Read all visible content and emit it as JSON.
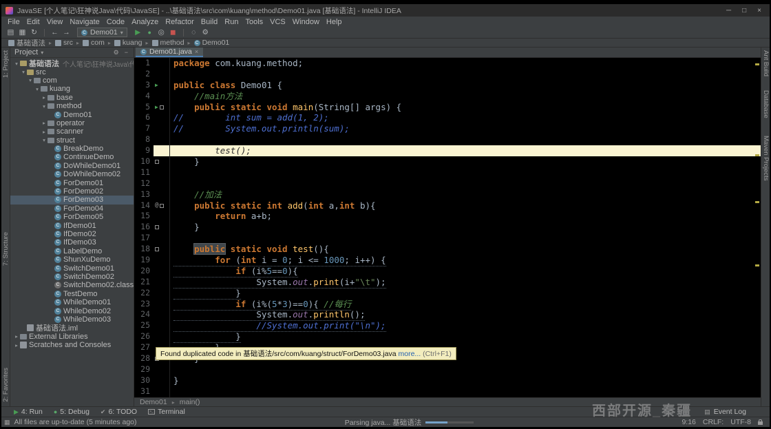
{
  "colors": {
    "keyword": "#CC7832",
    "method": "#FFC66B",
    "number": "#6897BB",
    "string": "#6A8759",
    "comment_green": "#5C9153",
    "comment_blue": "#4E6FD1",
    "static_field": "#9876AA",
    "editor_bg": "#000000",
    "panel_bg": "#3C3F41",
    "caret_line_bg": "#FBF4D2",
    "run_green": "#499C54",
    "tooltip_bg": "#F3EDBE"
  },
  "title_bar": {
    "title": "JavaSE [个人笔记\\狂神说Java\\代码\\JavaSE] - ..\\基础语法\\src\\com\\kuang\\method\\Demo01.java [基础语法] - IntelliJ IDEA",
    "minimize": "─",
    "maximize": "□",
    "close": "×"
  },
  "menu_bar": {
    "items": [
      "File",
      "Edit",
      "View",
      "Navigate",
      "Code",
      "Analyze",
      "Refactor",
      "Build",
      "Run",
      "Tools",
      "VCS",
      "Window",
      "Help"
    ]
  },
  "toolbar": {
    "run_config": "Demo01"
  },
  "nav_breadcrumbs": {
    "items": [
      {
        "label": "基础语法",
        "icon": "folder"
      },
      {
        "label": "src",
        "icon": "folder"
      },
      {
        "label": "com",
        "icon": "package"
      },
      {
        "label": "kuang",
        "icon": "package"
      },
      {
        "label": "method",
        "icon": "package"
      },
      {
        "label": "Demo01",
        "icon": "class"
      }
    ]
  },
  "left_stripe": {
    "items": [
      "1: Project",
      "7: Structure",
      "2: Favorites"
    ]
  },
  "right_stripe": {
    "items": [
      "Ant Build",
      "Database",
      "Maven Projects"
    ]
  },
  "project_panel": {
    "title": "Project",
    "tree": [
      {
        "label": "基础语法",
        "suffix": "个人笔记\\狂神说Java\\代码\\JavaSE",
        "depth": 0,
        "chev": "v",
        "icon": "folder",
        "bold": true
      },
      {
        "label": "src",
        "depth": 1,
        "chev": "v",
        "icon": "folder"
      },
      {
        "label": "com",
        "depth": 2,
        "chev": "v",
        "icon": "package"
      },
      {
        "label": "kuang",
        "depth": 3,
        "chev": "v",
        "icon": "package"
      },
      {
        "label": "base",
        "depth": 4,
        "chev": ">",
        "icon": "package"
      },
      {
        "label": "method",
        "depth": 4,
        "chev": "v",
        "icon": "package"
      },
      {
        "label": "Demo01",
        "depth": 5,
        "chev": "",
        "icon": "class"
      },
      {
        "label": "operator",
        "depth": 4,
        "chev": ">",
        "icon": "package"
      },
      {
        "label": "scanner",
        "depth": 4,
        "chev": ">",
        "icon": "package"
      },
      {
        "label": "struct",
        "depth": 4,
        "chev": "v",
        "icon": "package"
      },
      {
        "label": "BreakDemo",
        "depth": 5,
        "chev": "",
        "icon": "class"
      },
      {
        "label": "ContinueDemo",
        "depth": 5,
        "chev": "",
        "icon": "class"
      },
      {
        "label": "DoWhileDemo01",
        "depth": 5,
        "chev": "",
        "icon": "class"
      },
      {
        "label": "DoWhileDemo02",
        "depth": 5,
        "chev": "",
        "icon": "class"
      },
      {
        "label": "ForDemo01",
        "depth": 5,
        "chev": "",
        "icon": "class"
      },
      {
        "label": "ForDemo02",
        "depth": 5,
        "chev": "",
        "icon": "class"
      },
      {
        "label": "ForDemo03",
        "depth": 5,
        "chev": "",
        "icon": "class",
        "selected": true
      },
      {
        "label": "ForDemo04",
        "depth": 5,
        "chev": "",
        "icon": "class"
      },
      {
        "label": "ForDemo05",
        "depth": 5,
        "chev": "",
        "icon": "class"
      },
      {
        "label": "IfDemo01",
        "depth": 5,
        "chev": "",
        "icon": "class"
      },
      {
        "label": "IfDemo02",
        "depth": 5,
        "chev": "",
        "icon": "class"
      },
      {
        "label": "IfDemo03",
        "depth": 5,
        "chev": "",
        "icon": "class"
      },
      {
        "label": "LabelDemo",
        "depth": 5,
        "chev": "",
        "icon": "class"
      },
      {
        "label": "ShunXuDemo",
        "depth": 5,
        "chev": "",
        "icon": "class"
      },
      {
        "label": "SwitchDemo01",
        "depth": 5,
        "chev": "",
        "icon": "class"
      },
      {
        "label": "SwitchDemo02",
        "depth": 5,
        "chev": "",
        "icon": "class"
      },
      {
        "label": "SwitchDemo02.class",
        "depth": 5,
        "chev": "",
        "icon": "classfile"
      },
      {
        "label": "TestDemo",
        "depth": 5,
        "chev": "",
        "icon": "class"
      },
      {
        "label": "WhileDemo01",
        "depth": 5,
        "chev": "",
        "icon": "class"
      },
      {
        "label": "WhileDemo02",
        "depth": 5,
        "chev": "",
        "icon": "class"
      },
      {
        "label": "WhileDemo03",
        "depth": 5,
        "chev": "",
        "icon": "class"
      },
      {
        "label": "基础语法.iml",
        "depth": 1,
        "chev": "",
        "icon": "file"
      },
      {
        "label": "External Libraries",
        "depth": 0,
        "chev": ">",
        "icon": "lib"
      },
      {
        "label": "Scratches and Consoles",
        "depth": 0,
        "chev": ">",
        "icon": "scratch"
      }
    ]
  },
  "editor": {
    "tab": {
      "label": "Demo01.java",
      "close": "×"
    },
    "breadcrumb": [
      "Demo01",
      "main()"
    ],
    "lines": [
      {
        "n": 1,
        "tokens": [
          [
            "kw",
            "package"
          ],
          [
            "pl",
            " com.kuang.method;"
          ]
        ]
      },
      {
        "n": 2,
        "tokens": []
      },
      {
        "n": 3,
        "run": true,
        "tokens": [
          [
            "kw",
            "public"
          ],
          [
            "pl",
            " "
          ],
          [
            "kw",
            "class"
          ],
          [
            "pl",
            " Demo01 {"
          ]
        ]
      },
      {
        "n": 4,
        "tokens": [
          [
            "pl",
            "    "
          ],
          [
            "cg",
            "//main方法"
          ]
        ]
      },
      {
        "n": 5,
        "run": true,
        "fold": true,
        "tokens": [
          [
            "pl",
            "    "
          ],
          [
            "kw",
            "public"
          ],
          [
            "pl",
            " "
          ],
          [
            "kw",
            "static"
          ],
          [
            "pl",
            " "
          ],
          [
            "kw",
            "void"
          ],
          [
            "pl",
            " "
          ],
          [
            "fn",
            "main"
          ],
          [
            "pl",
            "(String[] args) {"
          ]
        ]
      },
      {
        "n": 6,
        "tokens": [
          [
            "cb",
            "//        int sum = add(1, 2);"
          ]
        ]
      },
      {
        "n": 7,
        "tokens": [
          [
            "cb",
            "//        System.out.println(sum);"
          ]
        ]
      },
      {
        "n": 8,
        "tokens": []
      },
      {
        "n": 9,
        "caret": true,
        "tokens": [
          [
            "pl",
            "        "
          ],
          [
            "dk",
            "test();"
          ]
        ]
      },
      {
        "n": 10,
        "fold": true,
        "tokens": [
          [
            "pl",
            "    }"
          ]
        ]
      },
      {
        "n": 11,
        "tokens": []
      },
      {
        "n": 12,
        "tokens": []
      },
      {
        "n": 13,
        "tokens": [
          [
            "pl",
            "    "
          ],
          [
            "cg",
            "//加法"
          ]
        ]
      },
      {
        "n": 14,
        "at": true,
        "fold": true,
        "tokens": [
          [
            "pl",
            "    "
          ],
          [
            "kw",
            "public"
          ],
          [
            "pl",
            " "
          ],
          [
            "kw",
            "static"
          ],
          [
            "pl",
            " "
          ],
          [
            "kw",
            "int"
          ],
          [
            "pl",
            " "
          ],
          [
            "fn",
            "add"
          ],
          [
            "pl",
            "("
          ],
          [
            "kw",
            "int"
          ],
          [
            "pl",
            " a,"
          ],
          [
            "kw",
            "int"
          ],
          [
            "pl",
            " b){"
          ]
        ]
      },
      {
        "n": 15,
        "tokens": [
          [
            "pl",
            "        "
          ],
          [
            "kw",
            "return"
          ],
          [
            "pl",
            " a+b;"
          ]
        ]
      },
      {
        "n": 16,
        "fold": true,
        "tokens": [
          [
            "pl",
            "    }"
          ]
        ]
      },
      {
        "n": 17,
        "tokens": []
      },
      {
        "n": 18,
        "fold": true,
        "tokens": [
          [
            "pl",
            "    "
          ],
          [
            "kwh",
            "public"
          ],
          [
            "pl",
            " "
          ],
          [
            "kw",
            "static"
          ],
          [
            "pl",
            " "
          ],
          [
            "kw",
            "void"
          ],
          [
            "pl",
            " "
          ],
          [
            "fn",
            "test"
          ],
          [
            "pl",
            "(){"
          ]
        ]
      },
      {
        "n": 19,
        "dup": true,
        "tokens": [
          [
            "pl",
            "        "
          ],
          [
            "kw",
            "for"
          ],
          [
            "pl",
            " ("
          ],
          [
            "kw",
            "int"
          ],
          [
            "pl",
            " i = "
          ],
          [
            "num",
            "0"
          ],
          [
            "pl",
            "; i <= "
          ],
          [
            "num",
            "1000"
          ],
          [
            "pl",
            "; i++) {"
          ]
        ]
      },
      {
        "n": 20,
        "dup": true,
        "tokens": [
          [
            "pl",
            "            "
          ],
          [
            "kw",
            "if"
          ],
          [
            "pl",
            " (i%"
          ],
          [
            "num",
            "5"
          ],
          [
            "pl",
            "=="
          ],
          [
            "num",
            "0"
          ],
          [
            "pl",
            "){"
          ]
        ]
      },
      {
        "n": 21,
        "dup": true,
        "tokens": [
          [
            "pl",
            "                System."
          ],
          [
            "fld",
            "out"
          ],
          [
            "pl",
            "."
          ],
          [
            "fn",
            "print"
          ],
          [
            "pl",
            "(i+"
          ],
          [
            "str",
            "\"\\t\""
          ],
          [
            "pl",
            ");"
          ]
        ]
      },
      {
        "n": 22,
        "dup": true,
        "tokens": [
          [
            "pl",
            "            }"
          ]
        ]
      },
      {
        "n": 23,
        "dup": true,
        "tokens": [
          [
            "pl",
            "            "
          ],
          [
            "kw",
            "if"
          ],
          [
            "pl",
            " (i%("
          ],
          [
            "num",
            "5"
          ],
          [
            "pl",
            "*"
          ],
          [
            "num",
            "3"
          ],
          [
            "pl",
            ")=="
          ],
          [
            "num",
            "0"
          ],
          [
            "pl",
            "){ "
          ],
          [
            "cg",
            "//每行"
          ]
        ]
      },
      {
        "n": 24,
        "dup": true,
        "tokens": [
          [
            "pl",
            "                System."
          ],
          [
            "fld",
            "out"
          ],
          [
            "pl",
            "."
          ],
          [
            "fn",
            "println"
          ],
          [
            "pl",
            "();"
          ]
        ]
      },
      {
        "n": 25,
        "dup": true,
        "tokens": [
          [
            "pl",
            "                "
          ],
          [
            "cb",
            "//System.out.print(\"\\n\");"
          ]
        ]
      },
      {
        "n": 26,
        "dup": true,
        "tokens": [
          [
            "pl",
            "            }"
          ]
        ]
      },
      {
        "n": 27,
        "tokens": [
          [
            "pl",
            "        }"
          ]
        ]
      },
      {
        "n": 28,
        "fold": true,
        "tokens": [
          [
            "pl",
            "    }"
          ]
        ]
      },
      {
        "n": 29,
        "tokens": []
      },
      {
        "n": 30,
        "tokens": [
          [
            "pl",
            "}"
          ]
        ]
      },
      {
        "n": 31,
        "tokens": []
      }
    ]
  },
  "tooltip": {
    "text": "Found duplicated code in 基础语法/src/com/kuang/struct/ForDemo03.java ",
    "link": "more...",
    "hint": " (Ctrl+F1)"
  },
  "bottom_bar": {
    "items": [
      {
        "label": "4: Run",
        "icon": "run"
      },
      {
        "label": "5: Debug",
        "icon": "debug"
      },
      {
        "label": "6: TODO",
        "icon": "todo"
      },
      {
        "label": "Terminal",
        "icon": "terminal"
      }
    ],
    "right": "Event Log"
  },
  "status_bar": {
    "left": "All files are up-to-date (5 minutes ago)",
    "progress_label": "Parsing java... 基础语法",
    "caret": "9:16",
    "line_sep": "CRLF:",
    "encoding": "UTF-8"
  },
  "watermark": {
    "text": "西部开源_秦疆"
  }
}
